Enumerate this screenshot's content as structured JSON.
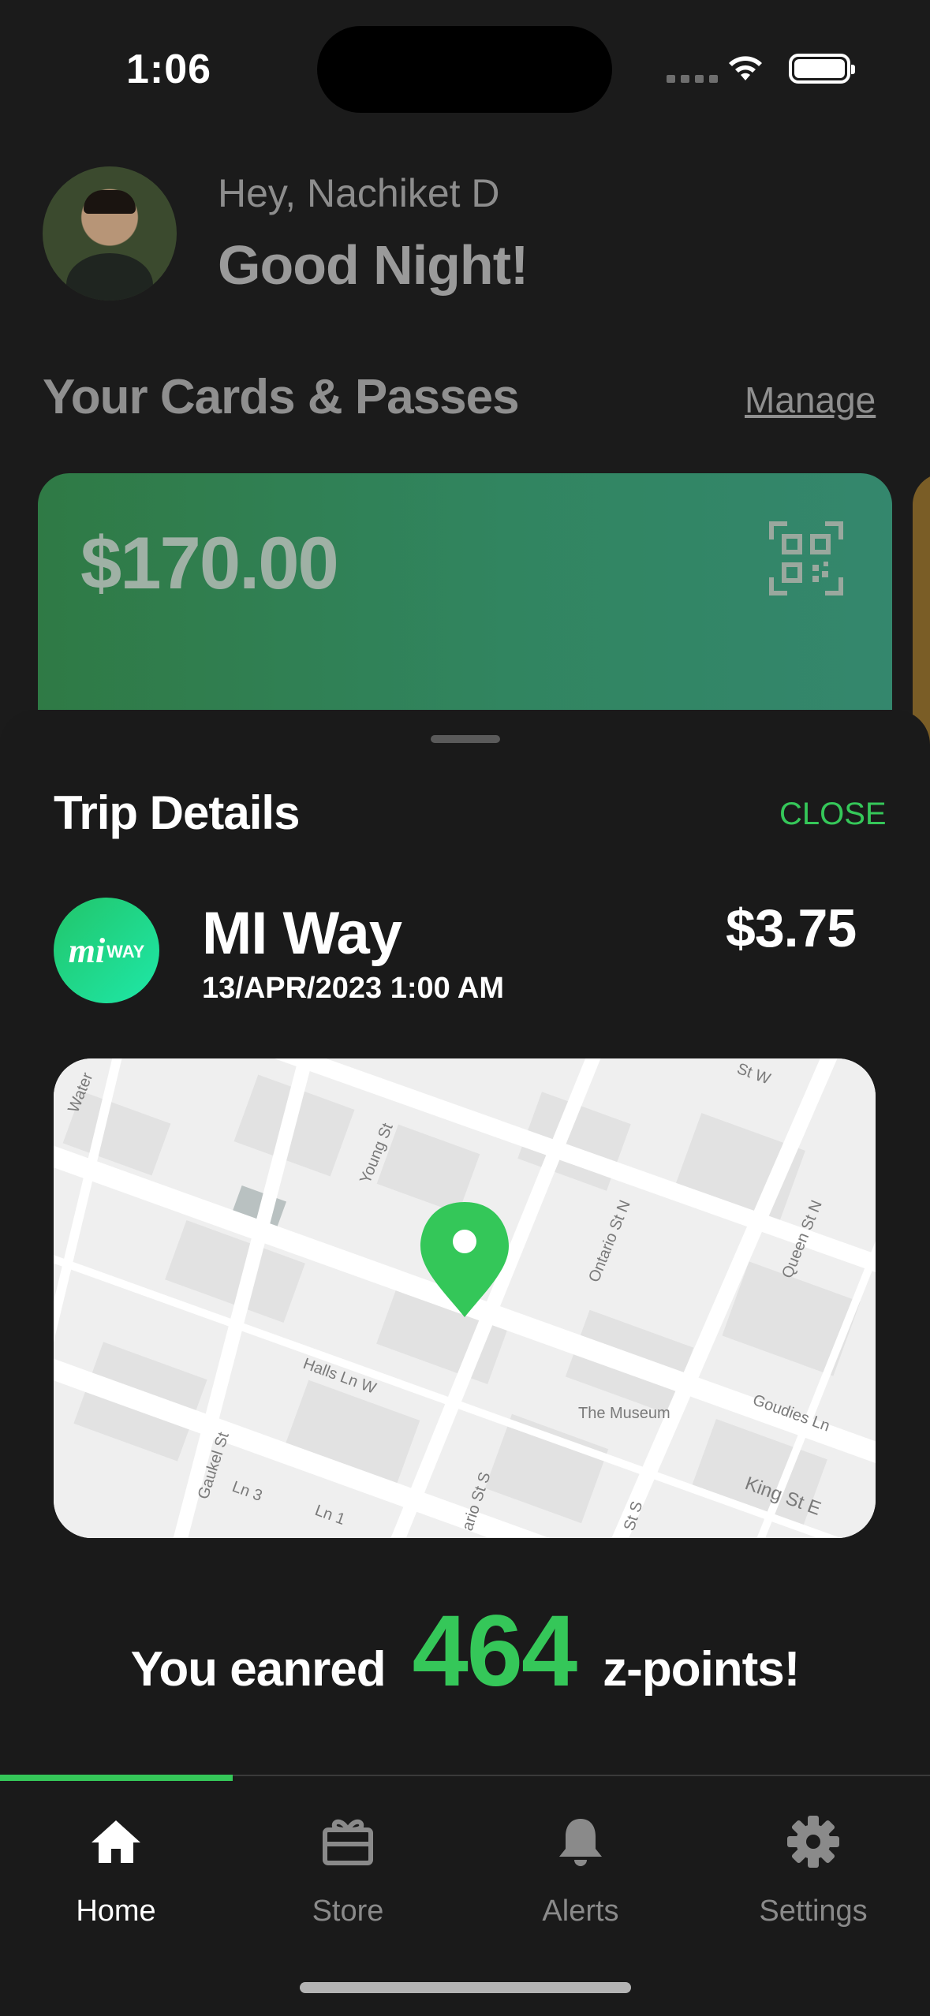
{
  "status_bar": {
    "time": "1:06",
    "icons": [
      "cellular-icon",
      "wifi-icon",
      "battery-icon"
    ]
  },
  "header": {
    "greeting": "Hey, Nachiket D",
    "salutation": "Good Night!"
  },
  "cards_section": {
    "title": "Your Cards & Passes",
    "manage_label": "Manage"
  },
  "card": {
    "balance": "$170.00",
    "icon": "qr-code-icon"
  },
  "trip_sheet": {
    "title": "Trip Details",
    "close_label": "CLOSE",
    "agency": {
      "logo_text": "mi",
      "logo_subtext": "WAY",
      "name": "MI Way"
    },
    "date": "13/APR/2023 1:00 AM",
    "fare": "$3.75",
    "map": {
      "labels": [
        "Young St",
        "Ontario St N",
        "Queen St N",
        "Halls Ln W",
        "The Museum",
        "Goudies Ln",
        "Gaukel St",
        "King St E",
        "Ln 3",
        "Ln 1",
        "Water",
        "ario St S",
        "St S",
        "St W"
      ],
      "pin_icon": "map-pin-icon"
    },
    "reward": {
      "prefix": "You eanred",
      "points": "464",
      "suffix": "z-points!"
    }
  },
  "tab_bar": {
    "tabs": [
      {
        "label": "Home",
        "icon": "home-icon",
        "active": true
      },
      {
        "label": "Store",
        "icon": "gift-icon",
        "active": false
      },
      {
        "label": "Alerts",
        "icon": "bell-icon",
        "active": false
      },
      {
        "label": "Settings",
        "icon": "gear-icon",
        "active": false
      }
    ]
  },
  "colors": {
    "accent": "#35c759",
    "background": "#1b1b1b",
    "card": "#318560"
  }
}
